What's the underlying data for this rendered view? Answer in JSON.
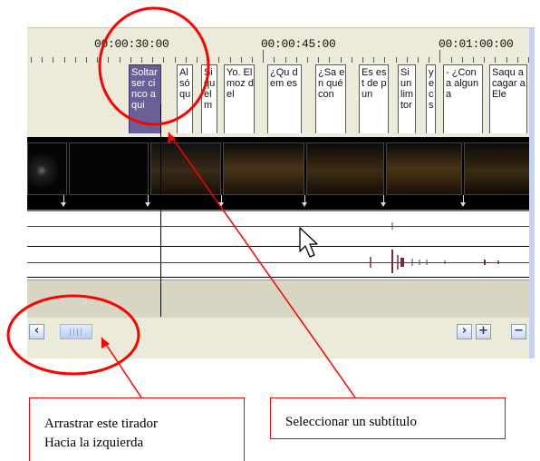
{
  "timeline": {
    "ruler_labels": [
      "00:00:30:00",
      "00:00:45:00",
      "00:01:00:00"
    ],
    "subtitles": [
      {
        "text": "Soltar ser cinco aqui",
        "selected": true
      },
      {
        "text": "Al só qu",
        "selected": false
      },
      {
        "text": "Si qu el m",
        "selected": false
      },
      {
        "text": "Yo. El moz del",
        "selected": false
      },
      {
        "text": "¿Qu dem es",
        "selected": false
      },
      {
        "text": "¿Sa en qué con",
        "selected": false
      },
      {
        "text": "Es est de pun",
        "selected": false
      },
      {
        "text": "Si un lim tor",
        "selected": false
      },
      {
        "text": "y e c s",
        "selected": false
      },
      {
        "text": "- ¿Con a alguna",
        "selected": false
      },
      {
        "text": "Saqu a cagar a Ele",
        "selected": false
      }
    ],
    "audio_colors": {
      "lines": "#7a2a3a",
      "dark": "#000000"
    }
  },
  "scrollbar": {
    "left_icon": "chevron-left-icon",
    "right_icon": "chevron-right-icon",
    "zoom_in_label": "+",
    "zoom_out_label": "−"
  },
  "annotations": {
    "drag_callout_line1": "Arrastrar este tirador",
    "drag_callout_line2": "Hacia la izquierda",
    "select_callout": "Seleccionar un subtítulo",
    "color": "#ff0000"
  }
}
